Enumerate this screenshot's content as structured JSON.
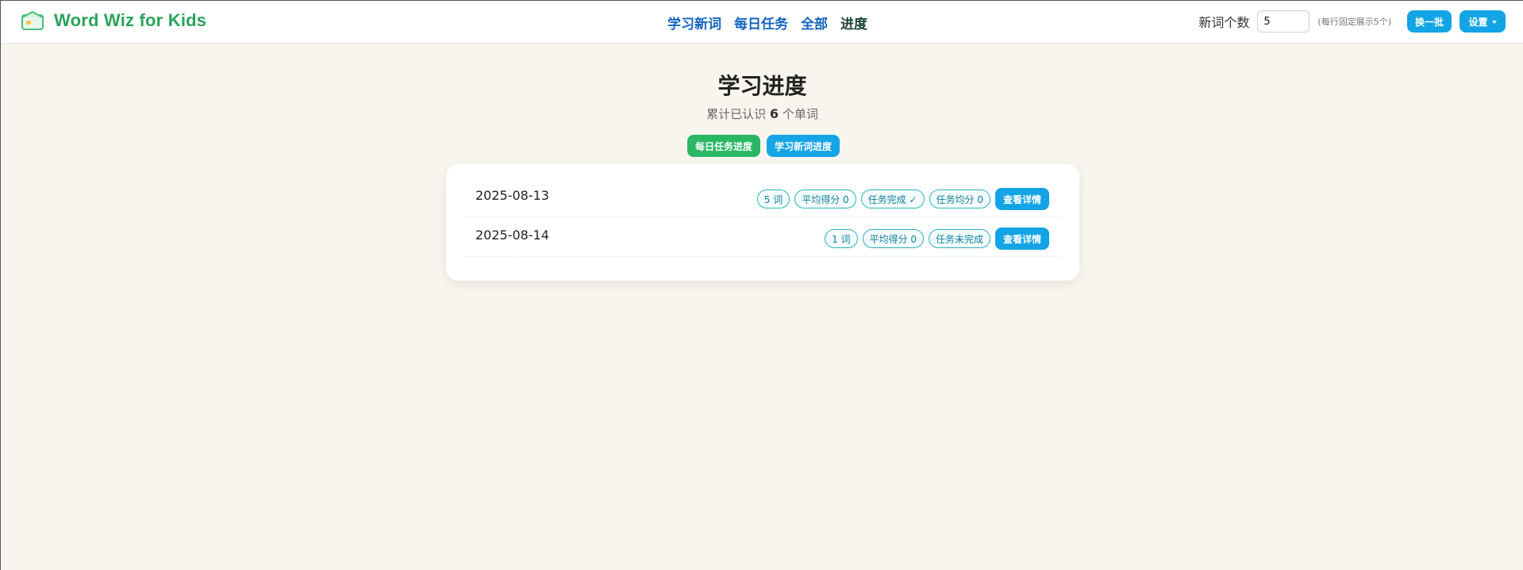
{
  "app": {
    "title": "Word Wiz for Kids"
  },
  "nav": [
    {
      "label": "学习新词",
      "active": false
    },
    {
      "label": "每日任务",
      "active": false
    },
    {
      "label": "全部",
      "active": false
    },
    {
      "label": "进度",
      "active": true
    }
  ],
  "controls": {
    "new_count_label": "新词个数",
    "new_count_value": "5",
    "new_count_note": "(每行固定展示5个)",
    "swap_label": "换一批",
    "settings_label": "设置"
  },
  "page": {
    "title": "学习进度",
    "subtitle_prefix": "累计已认识",
    "known_count": "6",
    "subtitle_suffix": "个单词"
  },
  "tabs": {
    "daily": "每日任务进度",
    "newwords": "学习新词进度"
  },
  "rows": [
    {
      "date": "2025-08-13",
      "words": "5 词",
      "avg": "平均得分 0",
      "status": "任务完成 ✓",
      "task_avg": "任务均分 0",
      "detail": "查看详情"
    },
    {
      "date": "2025-08-14",
      "words": "1 词",
      "avg": "平均得分 0",
      "status": "任务未完成",
      "detail": "查看详情"
    }
  ],
  "colors": {
    "brand": "#2aa45b",
    "accent_blue": "#12a4e4",
    "accent_green": "#29b765",
    "background": "#f8f5ef"
  }
}
